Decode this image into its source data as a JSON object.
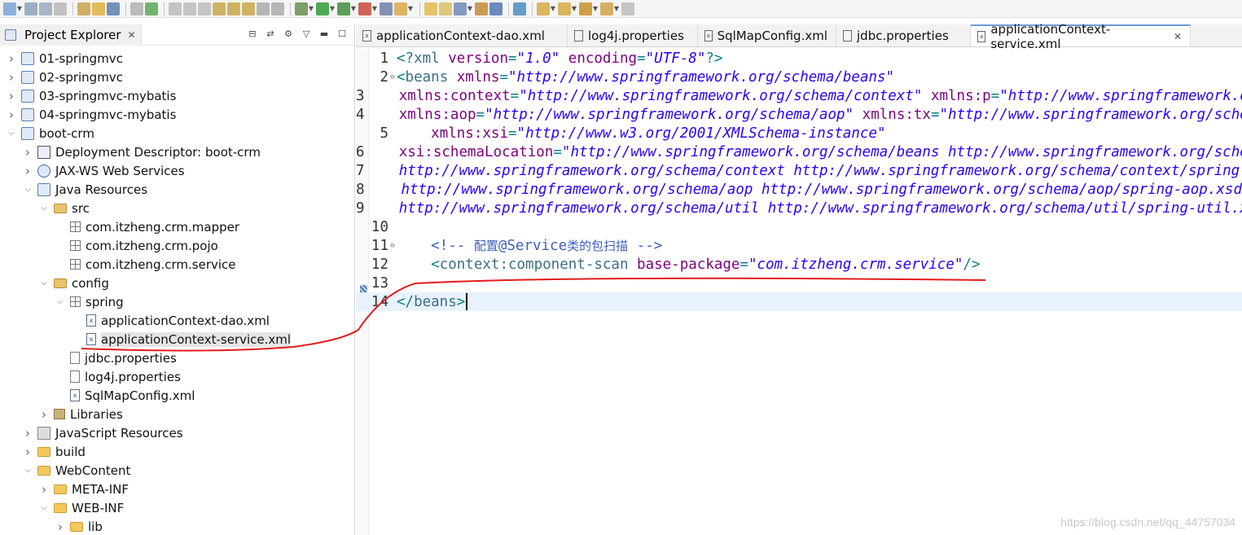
{
  "toolbar": {
    "icons": [
      "new-icon",
      "save-icon",
      "save-all-icon",
      "print-icon",
      "open-type-icon",
      "external-tools-icon",
      "console-icon",
      "skip-breakpoints-icon",
      "resume-icon",
      "suspend-icon",
      "terminate-icon",
      "disconnect-icon",
      "step-into-icon",
      "step-over-icon",
      "step-return-icon",
      "drop-to-frame-icon",
      "use-step-filters-icon",
      "debug-icon",
      "run-icon",
      "run-coverage-icon",
      "run-external-icon",
      "new-server-icon",
      "new-java-project-icon",
      "new-package-icon",
      "new-class-icon",
      "open-type-hierarchy-icon",
      "search-icon",
      "globe-icon",
      "run-last-icon",
      "next-annotation-icon",
      "previous-annotation-icon",
      "last-edit-location-icon",
      "back-icon",
      "forward-icon"
    ]
  },
  "explorer": {
    "title": "Project Explorer",
    "tree": [
      {
        "label": "01-springmvc",
        "icon": "project-icon",
        "expanded": false
      },
      {
        "label": "02-springmvc",
        "icon": "project-icon",
        "expanded": false
      },
      {
        "label": "03-springmvc-mybatis",
        "icon": "project-icon",
        "expanded": false
      },
      {
        "label": "04-springmvc-mybatis",
        "icon": "project-icon",
        "expanded": false
      },
      {
        "label": "boot-crm",
        "icon": "project-icon",
        "expanded": true
      },
      {
        "label": "Deployment Descriptor: boot-crm",
        "icon": "deployment-descriptor-icon",
        "expanded": false
      },
      {
        "label": "JAX-WS Web Services",
        "icon": "web-services-icon",
        "expanded": false
      },
      {
        "label": "Java Resources",
        "icon": "java-resources-icon",
        "expanded": true
      },
      {
        "label": "src",
        "icon": "source-folder-icon",
        "expanded": true
      },
      {
        "label": "com.itzheng.crm.mapper",
        "icon": "package-icon"
      },
      {
        "label": "com.itzheng.crm.pojo",
        "icon": "package-icon"
      },
      {
        "label": "com.itzheng.crm.service",
        "icon": "package-icon"
      },
      {
        "label": "config",
        "icon": "source-folder-icon",
        "expanded": true
      },
      {
        "label": "spring",
        "icon": "package-icon",
        "expanded": true
      },
      {
        "label": "applicationContext-dao.xml",
        "icon": "xml-file-icon"
      },
      {
        "label": "applicationContext-service.xml",
        "icon": "xml-file-icon",
        "selected": true
      },
      {
        "label": "jdbc.properties",
        "icon": "properties-file-icon"
      },
      {
        "label": "log4j.properties",
        "icon": "properties-file-icon"
      },
      {
        "label": "SqlMapConfig.xml",
        "icon": "xml-file-icon"
      },
      {
        "label": "Libraries",
        "icon": "libraries-icon",
        "expanded": false
      },
      {
        "label": "JavaScript Resources",
        "icon": "javascript-resources-icon",
        "expanded": false
      },
      {
        "label": "build",
        "icon": "folder-icon",
        "expanded": false
      },
      {
        "label": "WebContent",
        "icon": "folder-icon",
        "expanded": true
      },
      {
        "label": "META-INF",
        "icon": "folder-icon",
        "expanded": false
      },
      {
        "label": "WEB-INF",
        "icon": "folder-icon",
        "expanded": true
      },
      {
        "label": "lib",
        "icon": "folder-icon",
        "expanded": false
      }
    ]
  },
  "editor": {
    "tabs": [
      {
        "label": "applicationContext-dao.xml",
        "active": false
      },
      {
        "label": "log4j.properties",
        "active": false
      },
      {
        "label": "SqlMapConfig.xml",
        "active": false
      },
      {
        "label": "jdbc.properties",
        "active": false
      },
      {
        "label": "applicationContext-service.xml",
        "active": true
      }
    ],
    "current_line": 14,
    "lines": [
      {
        "n": "1",
        "tokens": [
          [
            "punc",
            "<?"
          ],
          [
            "tag",
            "xml "
          ],
          [
            "attr",
            "version"
          ],
          [
            "punc",
            "="
          ],
          [
            "val",
            "\"1.0\""
          ],
          [
            "tag",
            " "
          ],
          [
            "attr",
            "encoding"
          ],
          [
            "punc",
            "="
          ],
          [
            "val",
            "\"UTF-8\""
          ],
          [
            "punc",
            "?>"
          ]
        ]
      },
      {
        "n": "2",
        "fold": "⊖",
        "tokens": [
          [
            "punc",
            "<"
          ],
          [
            "tag",
            "beans "
          ],
          [
            "attr",
            "xmlns"
          ],
          [
            "punc",
            "="
          ],
          [
            "val",
            "\"http://www.springframework.org/schema/beans\""
          ]
        ]
      },
      {
        "n": "3",
        "tokens": [
          [
            "tag",
            "    "
          ],
          [
            "attr",
            "xmlns:context"
          ],
          [
            "punc",
            "="
          ],
          [
            "val",
            "\"http://www.springframework.org/schema/context\""
          ],
          [
            "tag",
            " "
          ],
          [
            "attr",
            "xmlns:p"
          ],
          [
            "punc",
            "="
          ],
          [
            "val",
            "\"http://www.springframework.org/schema/p\""
          ]
        ]
      },
      {
        "n": "4",
        "tokens": [
          [
            "tag",
            "    "
          ],
          [
            "attr",
            "xmlns:aop"
          ],
          [
            "punc",
            "="
          ],
          [
            "val",
            "\"http://www.springframework.org/schema/aop\""
          ],
          [
            "tag",
            " "
          ],
          [
            "attr",
            "xmlns:tx"
          ],
          [
            "punc",
            "="
          ],
          [
            "val",
            "\"http://www.springframework.org/schema/tx\""
          ]
        ]
      },
      {
        "n": "5",
        "tokens": [
          [
            "tag",
            "    "
          ],
          [
            "attr",
            "xmlns:xsi"
          ],
          [
            "punc",
            "="
          ],
          [
            "val",
            "\"http://www.w3.org/2001/XMLSchema-instance\""
          ]
        ]
      },
      {
        "n": "6",
        "tokens": [
          [
            "tag",
            "    "
          ],
          [
            "attr",
            "xsi:schemaLocation"
          ],
          [
            "punc",
            "="
          ],
          [
            "val",
            "\"http://www.springframework.org/schema/beans http://www.springframework.org/schema/beans/spring-beans.xsd"
          ]
        ]
      },
      {
        "n": "7",
        "tokens": [
          [
            "val",
            "    http://www.springframework.org/schema/context http://www.springframework.org/schema/context/spring-context.xsd"
          ]
        ]
      },
      {
        "n": "8",
        "tokens": [
          [
            "val",
            "    http://www.springframework.org/schema/aop http://www.springframework.org/schema/aop/spring-aop.xsd"
          ]
        ]
      },
      {
        "n": "9",
        "tokens": [
          [
            "val",
            "    http://www.springframework.org/schema/util http://www.springframework.org/schema/util/spring-util.xsd\">"
          ]
        ]
      },
      {
        "n": "10",
        "tokens": []
      },
      {
        "n": "11",
        "fold": "⊖",
        "tokens": [
          [
            "cmt",
            "    <!-- "
          ],
          [
            "cmtcn",
            "配置"
          ],
          [
            "cmt",
            "@Service"
          ],
          [
            "cmtcn",
            "类的包扫描"
          ],
          [
            "cmt",
            " -->"
          ]
        ]
      },
      {
        "n": "12",
        "tokens": [
          [
            "tag",
            "    "
          ],
          [
            "punc",
            "<"
          ],
          [
            "tag",
            "context:component-scan "
          ],
          [
            "attr",
            "base-package"
          ],
          [
            "punc",
            "="
          ],
          [
            "val",
            "\"com.itzheng.crm.service\""
          ],
          [
            "punc",
            "/>"
          ]
        ]
      },
      {
        "n": "13",
        "tokens": []
      },
      {
        "n": "14",
        "tokens": [
          [
            "punc",
            "</"
          ],
          [
            "tag",
            "beans"
          ],
          [
            "punc",
            ">"
          ]
        ]
      }
    ]
  },
  "watermark": "https://blog.csdn.net/qq_44757034",
  "colors": {
    "annotation": "#e31b1b",
    "active_tab_border": "#6b9bd8",
    "current_line": "#e8f2fe"
  }
}
